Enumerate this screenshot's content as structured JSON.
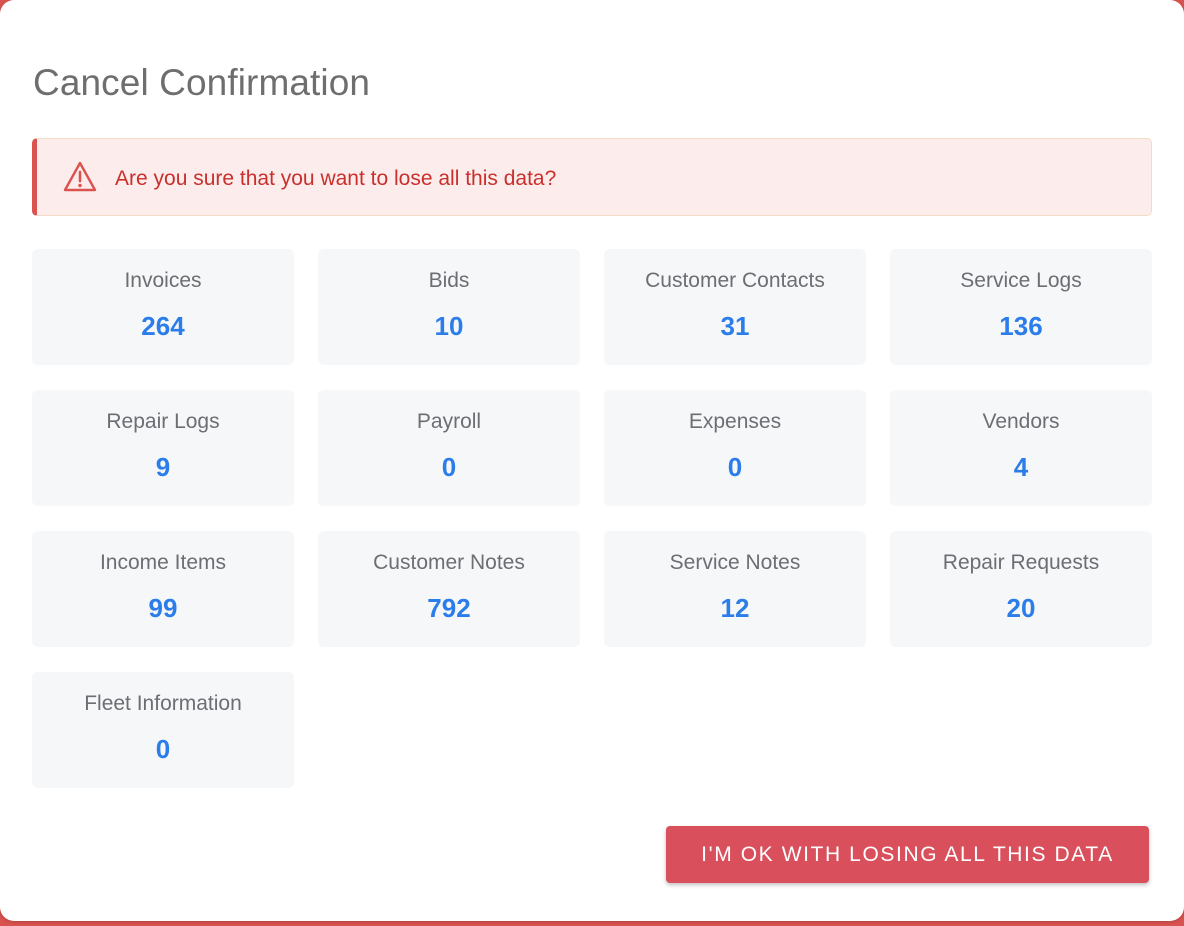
{
  "dialog": {
    "title": "Cancel Confirmation",
    "accent_color": "#d9534f"
  },
  "alert": {
    "icon": "warning-triangle-icon",
    "message": "Are you sure that you want to lose all this data?",
    "text_color": "#c9302c",
    "background_color": "#fdecec"
  },
  "stats": [
    {
      "label": "Invoices",
      "value": "264"
    },
    {
      "label": "Bids",
      "value": "10"
    },
    {
      "label": "Customer Contacts",
      "value": "31"
    },
    {
      "label": "Service Logs",
      "value": "136"
    },
    {
      "label": "Repair Logs",
      "value": "9"
    },
    {
      "label": "Payroll",
      "value": "0"
    },
    {
      "label": "Expenses",
      "value": "0"
    },
    {
      "label": "Vendors",
      "value": "4"
    },
    {
      "label": "Income Items",
      "value": "99"
    },
    {
      "label": "Customer Notes",
      "value": "792"
    },
    {
      "label": "Service Notes",
      "value": "12"
    },
    {
      "label": "Repair Requests",
      "value": "20"
    },
    {
      "label": "Fleet Information",
      "value": "0"
    }
  ],
  "value_color": "#2b7de9",
  "actions": {
    "confirm_label": "I'M OK WITH LOSING ALL THIS DATA",
    "confirm_color": "#d9505c"
  }
}
